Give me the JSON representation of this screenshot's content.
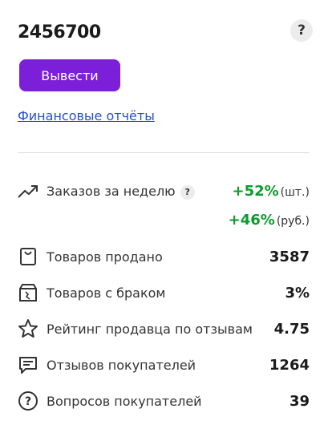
{
  "balance": "2456700",
  "help_icon_glyph": "?",
  "withdraw_label": "Вывести",
  "reports_link": "Финансовые отчёты",
  "orders": {
    "label": "Заказов за неделю",
    "badge": "?",
    "pct_items": "+52%",
    "unit_items": "(шт.)",
    "pct_rub": "+46%",
    "unit_rub": "(руб.)"
  },
  "stats": [
    {
      "label": "Товаров продано",
      "value": "3587",
      "icon": "bag-icon"
    },
    {
      "label": "Товаров с браком",
      "value": "3%",
      "icon": "damaged-box-icon"
    },
    {
      "label": "Рейтинг продавца по отзывам",
      "value": "4.75",
      "icon": "star-icon"
    },
    {
      "label": "Отзывов покупателей",
      "value": "1264",
      "icon": "comment-icon"
    },
    {
      "label": "Вопросов покупателей",
      "value": "39",
      "icon": "question-circle-icon"
    }
  ],
  "colors": {
    "accent": "#7b1fd9",
    "link": "#2451c9",
    "positive": "#0a9b2e"
  }
}
